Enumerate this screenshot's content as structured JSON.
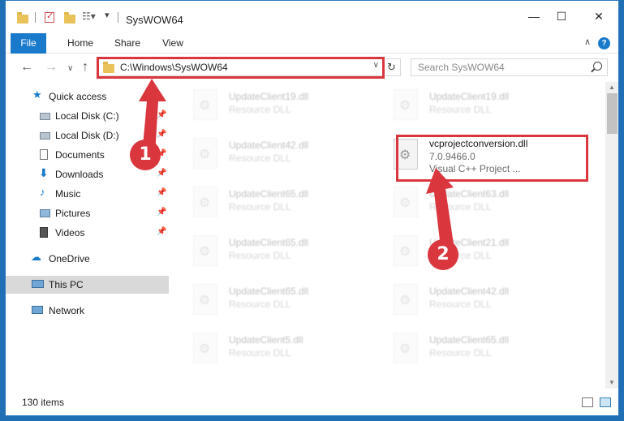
{
  "window": {
    "title": "SysWOW64",
    "minimize": "—",
    "maximize": "☐",
    "close": "✕"
  },
  "ribbon": {
    "tabs": [
      "File",
      "Home",
      "Share",
      "View"
    ],
    "help": "?",
    "collapse": "∧"
  },
  "address": {
    "path": "C:\\Windows\\SysWOW64",
    "refresh": "↻",
    "dropdown": "∨"
  },
  "nav_buttons": {
    "back": "←",
    "forward": "→",
    "recent": "∨",
    "up": "↑"
  },
  "search": {
    "placeholder": "Search SysWOW64"
  },
  "navpane": {
    "items": [
      {
        "label": "Quick access",
        "icon": "star-icon"
      },
      {
        "label": "Local Disk (C:)",
        "icon": "drive-icon"
      },
      {
        "label": "Local Disk (D:)",
        "icon": "drive-icon"
      },
      {
        "label": "Documents",
        "icon": "documents-icon"
      },
      {
        "label": "Downloads",
        "icon": "download-icon"
      },
      {
        "label": "Music",
        "icon": "music-icon"
      },
      {
        "label": "Pictures",
        "icon": "pictures-icon"
      },
      {
        "label": "Videos",
        "icon": "videos-icon"
      },
      {
        "label": "OneDrive",
        "icon": "cloud-icon"
      },
      {
        "label": "This PC",
        "icon": "computer-icon"
      },
      {
        "label": "Network",
        "icon": "network-icon"
      }
    ]
  },
  "files": {
    "left": [
      {
        "name": "UpdateClient19.dll",
        "type": "Resource DLL"
      },
      {
        "name": "UpdateClient42.dll",
        "type": "Resource DLL"
      },
      {
        "name": "UpdateClient65.dll",
        "type": "Resource DLL"
      },
      {
        "name": "UpdateClient65.dll",
        "type": "Resource DLL"
      },
      {
        "name": "UpdateClient65.dll",
        "type": "Resource DLL"
      },
      {
        "name": "UpdateClient5.dll",
        "type": "Resource DLL"
      }
    ],
    "right": [
      {
        "name": "UpdateClient19.dll",
        "type": "Resource DLL"
      },
      {
        "name": "UpdateClient63.dll",
        "type": "Resource DLL"
      },
      {
        "name": "UpdateClient21.dll",
        "type": "Resource DLL"
      },
      {
        "name": "UpdateClient42.dll",
        "type": "Resource DLL"
      },
      {
        "name": "UpdateClient65.dll",
        "type": "Resource DLL"
      }
    ],
    "highlighted": {
      "name": "vcprojectconversion.dll",
      "version": "7.0.9466.0",
      "description": "Visual C++ Project ..."
    }
  },
  "status": {
    "count": "130 items"
  },
  "annotations": {
    "step1": "1",
    "step2": "2",
    "color": "#d9363e"
  },
  "colors": {
    "accent": "#1979ca",
    "highlight_box": "#d9363e"
  }
}
